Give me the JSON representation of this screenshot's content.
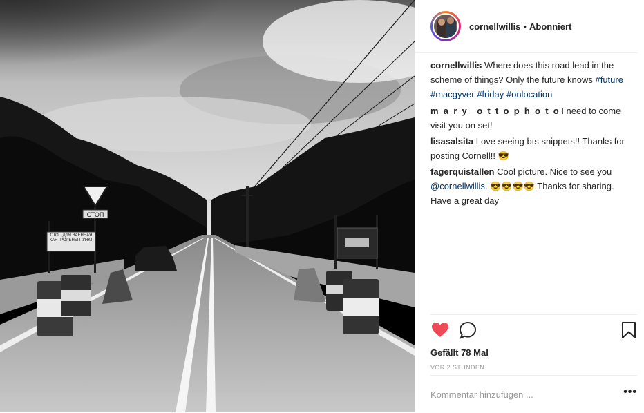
{
  "post": {
    "username": "cornellwillis",
    "separator": "•",
    "follow_status": "Abonniert",
    "caption": {
      "user": "cornellwillis",
      "text": "Where does this road lead in the scheme of things? Only the future knows",
      "hashtags": [
        "#future",
        "#macgyver",
        "#friday",
        "#onlocation"
      ]
    },
    "comments": [
      {
        "user": "m_a_r_y__o_t_t_o_p_h_o_t_o",
        "text": "I need to come visit you on set!"
      },
      {
        "user": "lisasalsita",
        "text": "Love seeing bts snippets!! Thanks for posting Cornell!! 😎"
      },
      {
        "user": "fagerquistallen",
        "text_before": "Cool picture. Nice to see you",
        "mention": "@cornellwillis",
        "text_after": ". 😎😎😎😎 Thanks for sharing. Have a great day"
      }
    ],
    "likes": "Gefällt 78 Mal",
    "timestamp": "VOR 2 STUNDEN",
    "comment_placeholder": "Kommentar hinzufügen ...",
    "more_label": "•••",
    "photo_signs": {
      "left_sign_top": "СТОП",
      "left_sign_board": "СТОП ДЛЯ ВАЕННАЯ КАНТРОЛЬНЫ ПУНКТ"
    },
    "colors": {
      "like_red": "#ed4956",
      "hashtag": "#003569",
      "border": "#efefef",
      "muted": "#999999"
    },
    "icons": [
      "heart-icon",
      "comment-icon",
      "bookmark-icon",
      "more-options-icon"
    ]
  }
}
